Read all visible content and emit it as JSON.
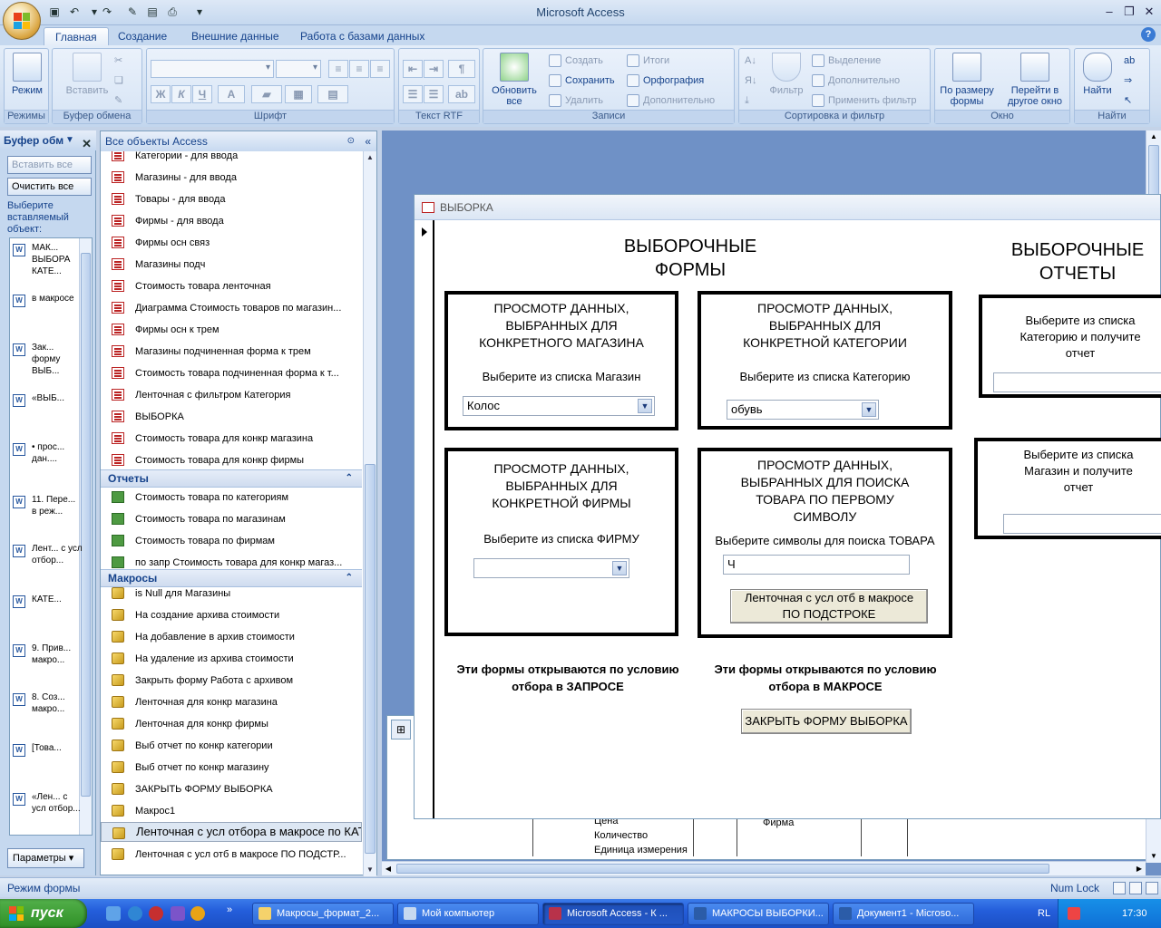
{
  "window": {
    "title": "Microsoft Access"
  },
  "ribbon": {
    "tabs": [
      "Главная",
      "Создание",
      "Внешние данные",
      "Работа с базами данных"
    ],
    "groups": {
      "views": {
        "label": "Режимы",
        "mode": "Режим"
      },
      "clipboard": {
        "label": "Буфер обмена",
        "paste": "Вставить"
      },
      "font": {
        "label": "Шрифт",
        "bold": "Ж",
        "italic": "К",
        "underline": "Ч",
        "fontcolor": "A"
      },
      "richtext": {
        "label": "Текст RTF"
      },
      "records": {
        "label": "Записи",
        "refresh": "Обновить все",
        "new": "Создать",
        "save": "Сохранить",
        "delete": "Удалить",
        "totals": "Итоги",
        "spelling": "Орфография",
        "more": "Дополнительно"
      },
      "sort": {
        "label": "Сортировка и фильтр",
        "filter": "Фильтр",
        "selection": "Выделение",
        "advanced": "Дополнительно",
        "apply": "Применить фильтр"
      },
      "window": {
        "label": "Окно",
        "fit": "По размеру формы",
        "switch": "Перейти в другое окно"
      },
      "find": {
        "label": "Найти",
        "find": "Найти"
      }
    }
  },
  "clipboard_pane": {
    "title": "Буфер обм",
    "paste_all": "Вставить все",
    "clear_all": "Очистить все",
    "hint": "Выберите вставляемый объект:",
    "items": [
      "МАК... ВЫБОРА КАТЕ...",
      "в макросе",
      "Зак... форму ВЫБ...",
      "«ВЫБ...",
      "• прос... дан....",
      "11. Пере... в реж...",
      "Лент... с усл отбор...",
      "КАТЕ...",
      "9. Прив... макро...",
      "8. Соз... макро...",
      "[Това...",
      "«Лен... с усл отбор..."
    ],
    "params": "Параметры"
  },
  "nav_pane": {
    "title": "Все объекты Access",
    "forms": [
      "Категории - для ввода",
      "Магазины - для ввода",
      "Товары - для ввода",
      "Фирмы - для ввода",
      "Фирмы осн связ",
      "Магазины подч",
      "Стоимость товара ленточная",
      "Диаграмма Стоимость товаров по  магазин...",
      "Фирмы осн к трем",
      "Магазины подчиненная форма к трем",
      "Стоимость товара подчиненная форма к т...",
      "Ленточная с фильтром Категория",
      "ВЫБОРКА",
      "Стоимость товара для конкр магазина",
      "Стоимость товара для конкр фирмы"
    ],
    "reports_label": "Отчеты",
    "reports": [
      "Стоимость товара по категориям",
      "Стоимость товара по магазинам",
      "Стоимость товара по фирмам",
      "по запр Стоимость товара для конкр магаз..."
    ],
    "macros_label": "Макросы",
    "macros": [
      "is Null для Магазины",
      "На создание архива стоимости",
      "На добавление в архив стоимости",
      "На удаление из архива стоимости",
      "Закрыть форму Работа с архивом",
      "Ленточная для конкр магазина",
      "Ленточная для конкр фирмы",
      "Выб отчет по конкр категории",
      "Выб отчет по конкр магазину",
      "ЗАКРЫТЬ ФОРМУ ВЫБОРКА",
      "Макрос1",
      "Ленточная с усл отбора в макросе по КАТЕГ...",
      "Ленточная с усл отб в макросе ПО ПОДСТР..."
    ]
  },
  "background_doc": {
    "fields": [
      "Цена",
      "Количество",
      "Единица измерения"
    ],
    "firm": "Фирма"
  },
  "form": {
    "window_title": "ВЫБОРКА",
    "heading_forms": [
      "ВЫБОРОЧНЫЕ",
      "ФОРМЫ"
    ],
    "heading_reports": [
      "ВЫБОРОЧНЫЕ",
      "ОТЧЕТЫ"
    ],
    "box_store": {
      "title": [
        "ПРОСМОТР ДАННЫХ,",
        "ВЫБРАННЫХ ДЛЯ",
        "КОНКРЕТНОГО МАГАЗИНА"
      ],
      "label": "Выберите из списка Магазин",
      "value": "Колос"
    },
    "box_category": {
      "title": [
        "ПРОСМОТР ДАННЫХ,",
        "ВЫБРАННЫХ ДЛЯ",
        "КОНКРЕТНОЙ КАТЕГОРИИ"
      ],
      "label": "Выберите из списка Категорию",
      "value": "обувь"
    },
    "box_firm": {
      "title": [
        "ПРОСМОТР ДАННЫХ,",
        "ВЫБРАННЫХ ДЛЯ",
        "КОНКРЕТНОЙ ФИРМЫ"
      ],
      "label": "Выберите из списка ФИРМУ",
      "value": ""
    },
    "box_search": {
      "title": [
        "ПРОСМОТР ДАННЫХ,",
        "ВЫБРАННЫХ ДЛЯ ПОИСКА",
        "ТОВАРА ПО ПЕРВОМУ",
        "СИМВОЛУ"
      ],
      "label": "Выберите символы для поиска ТОВАРА",
      "value": "Ч",
      "button": [
        "Ленточная с усл отб в макросе",
        "ПО ПОДСТРОКЕ"
      ]
    },
    "box_report_cat": {
      "label": [
        "Выберите из списка",
        "Категорию и получите",
        "отчет"
      ]
    },
    "box_report_store": {
      "label": [
        "Выберите из списка",
        "Магазин и получите",
        "отчет"
      ]
    },
    "note_query": [
      "Эти формы открываются по условию",
      "отбора в ЗАПРОСЕ"
    ],
    "note_macro": [
      "Эти формы открываются по условию",
      "отбора в МАКРОСЕ"
    ],
    "close_button": "ЗАКРЫТЬ ФОРМУ ВЫБОРКА"
  },
  "status": {
    "mode": "Режим формы",
    "numlock": "Num Lock"
  },
  "taskbar": {
    "start": "пуск",
    "tasks": [
      "Макросы_формат_2...",
      "Мой компьютер",
      "Microsoft Access - К ...",
      "МАКРОСЫ ВЫБОРКИ...",
      "Документ1 - Microso..."
    ],
    "lang": "RL",
    "time": "17:30"
  }
}
